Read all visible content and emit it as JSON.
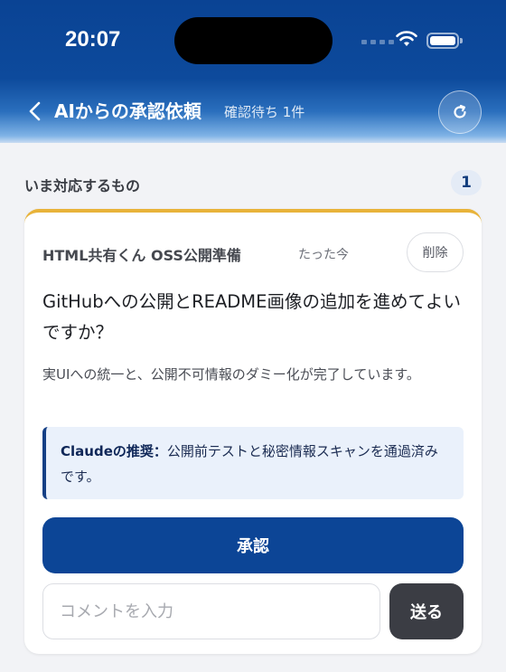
{
  "status_bar": {
    "time": "20:07"
  },
  "nav": {
    "title": "AIからの承認依頼",
    "subtitle": "確認待ち 1件",
    "back_icon": "chevron-left-icon",
    "refresh_icon": "refresh-icon"
  },
  "section": {
    "title": "いま対応するもの",
    "count": "1"
  },
  "card": {
    "project": "HTML共有くん OSS公開準備",
    "time": "たった今",
    "delete_label": "削除",
    "question": "GitHubへの公開とREADME画像の追加を進めてよいですか？",
    "description": "実UIへの統一と、公開不可情報のダミー化が完了しています。",
    "recommendation_label": "Claudeの推奨：",
    "recommendation_text": "公開前テストと秘密情報スキャンを通過済みです。",
    "approve_label": "承認",
    "comment_placeholder": "コメントを入力",
    "send_label": "送る",
    "accent_color": "#e8b33a"
  },
  "colors": {
    "primary": "#0c4596",
    "send": "#3b3d44"
  }
}
